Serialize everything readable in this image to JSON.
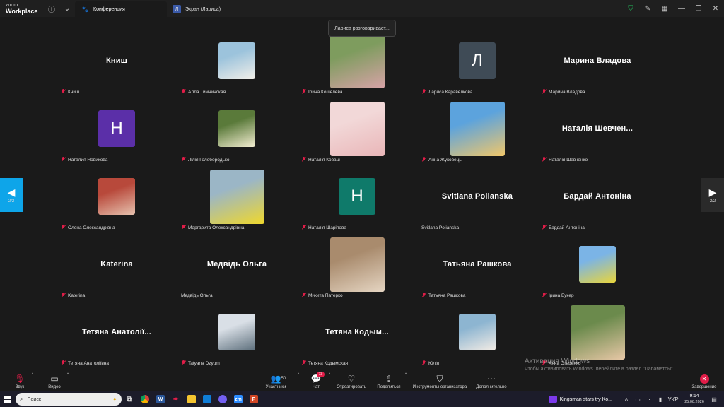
{
  "app": {
    "logo_line1": "zoom",
    "logo_line2": "Workplace"
  },
  "tabs": [
    {
      "label": "Конференция",
      "icon": "paw-icon"
    },
    {
      "label": "Экран (Лариса)",
      "icon": "screen-share-icon",
      "icon_letter": "Л"
    }
  ],
  "speaking_tooltip": "Лариса разговаривает...",
  "pager": {
    "page": "2/2"
  },
  "participants": [
    {
      "name": "Книш",
      "display": "name",
      "big": "Книш"
    },
    {
      "name": "Алла Тимчинская",
      "display": "photo",
      "photo": "woman-white-top"
    },
    {
      "name": "Ірина Кошелева",
      "display": "photo-large",
      "photo": "woman-floral"
    },
    {
      "name": "Лариса Каравелкова",
      "display": "letter",
      "letter": "Л",
      "color": "#3f4b56"
    },
    {
      "name": "Марина Владова",
      "display": "name",
      "big": "Марина Владова"
    },
    {
      "name": "Наталия Новикова",
      "display": "letter",
      "letter": "Н",
      "color": "#5b2fa8"
    },
    {
      "name": "Лілія Голобородько",
      "display": "photo",
      "photo": "flowers"
    },
    {
      "name": "Наталія Коваш",
      "display": "photo-large",
      "photo": "woman-pink"
    },
    {
      "name": "Анна Жуковець",
      "display": "photo-large",
      "photo": "sunset"
    },
    {
      "name": "Наталія Шевченко",
      "display": "name",
      "big": "Наталія  Шевчен..."
    },
    {
      "name": "Олена Олександрівна",
      "display": "photo",
      "photo": "woman-red-hair"
    },
    {
      "name": "Маргарита Олександрівна",
      "display": "photo-large",
      "photo": "woman-sunglasses"
    },
    {
      "name": "Наталія Шаріпова",
      "display": "letter",
      "letter": "Н",
      "color": "#0f7a6a"
    },
    {
      "name": "Svitlana Polianska",
      "display": "name",
      "big": "Svitlana Polianska",
      "unmuted": true
    },
    {
      "name": "Бардай Антоніна",
      "display": "name",
      "big": "Бардай Антоніна"
    },
    {
      "name": "Katerina",
      "display": "name",
      "big": "Katerina"
    },
    {
      "name": "Медвідь Ольга",
      "display": "name",
      "big": "Медвідь Ольга",
      "unmuted": true
    },
    {
      "name": "Микита Патерко",
      "display": "photo-large",
      "photo": "man-cap"
    },
    {
      "name": "Татьяна Рашкова",
      "display": "name",
      "big": "Татьяна Рашкова"
    },
    {
      "name": "Ірина Букер",
      "display": "photo",
      "photo": "woman-yellow-field"
    },
    {
      "name": "Тетяна Анатоліївна",
      "display": "name",
      "big": "Тетяна  Анатолії..."
    },
    {
      "name": "Tatyana Dzyum",
      "display": "photo",
      "photo": "woman-desk"
    },
    {
      "name": "Тетяна Кодымская",
      "display": "name",
      "big": "Тетяна  Кодым..."
    },
    {
      "name": "Юлія",
      "display": "photo",
      "photo": "woman-glasses"
    },
    {
      "name": "Анна Стеценко",
      "display": "photo-large",
      "photo": "woman-portrait"
    }
  ],
  "photo_colors": {
    "woman-white-top": [
      "#9cc3dc",
      "#f2efe9"
    ],
    "woman-floral": [
      "#7e9c5e",
      "#d7a3a7"
    ],
    "flowers": [
      "#5a7a3a",
      "#f4eed2"
    ],
    "woman-pink": [
      "#f2d8d8",
      "#e9b6b8"
    ],
    "sunset": [
      "#5ca3dd",
      "#f1c76a"
    ],
    "woman-red-hair": [
      "#b8493b",
      "#e6c1ae"
    ],
    "woman-sunglasses": [
      "#9bb6c6",
      "#f0d82c"
    ],
    "man-cap": [
      "#a98b6d",
      "#e5d5c2"
    ],
    "woman-yellow-field": [
      "#7bb4e6",
      "#e9d53b"
    ],
    "woman-desk": [
      "#d9dfe6",
      "#5d6f7c"
    ],
    "woman-glasses": [
      "#8db5d1",
      "#f3ece5"
    ],
    "woman-portrait": [
      "#6b8a4c",
      "#e7c7a6"
    ]
  },
  "watermark": {
    "title": "Активация Windows",
    "subtitle": "Чтобы активировать Windows, перейдите в раздел \"Параметры\"."
  },
  "controls": {
    "audio": "Звук",
    "video": "Видео",
    "participants": "Участники",
    "participants_count": "50",
    "chat": "Чат",
    "chat_badge": "73",
    "react": "Отреагировать",
    "share": "Поделиться",
    "host_tools": "Инструменты организатора",
    "more": "Дополнительно",
    "end": "Завершение"
  },
  "taskbar": {
    "search_placeholder": "Поиск",
    "news": "Kingsman stars try Ko...",
    "lang": "УКР",
    "time": "9:14",
    "date": "25.08.2026"
  },
  "colors": {
    "accent": "#0ea5e9",
    "end": "#e11d48",
    "mic_off": "#e11d48"
  }
}
